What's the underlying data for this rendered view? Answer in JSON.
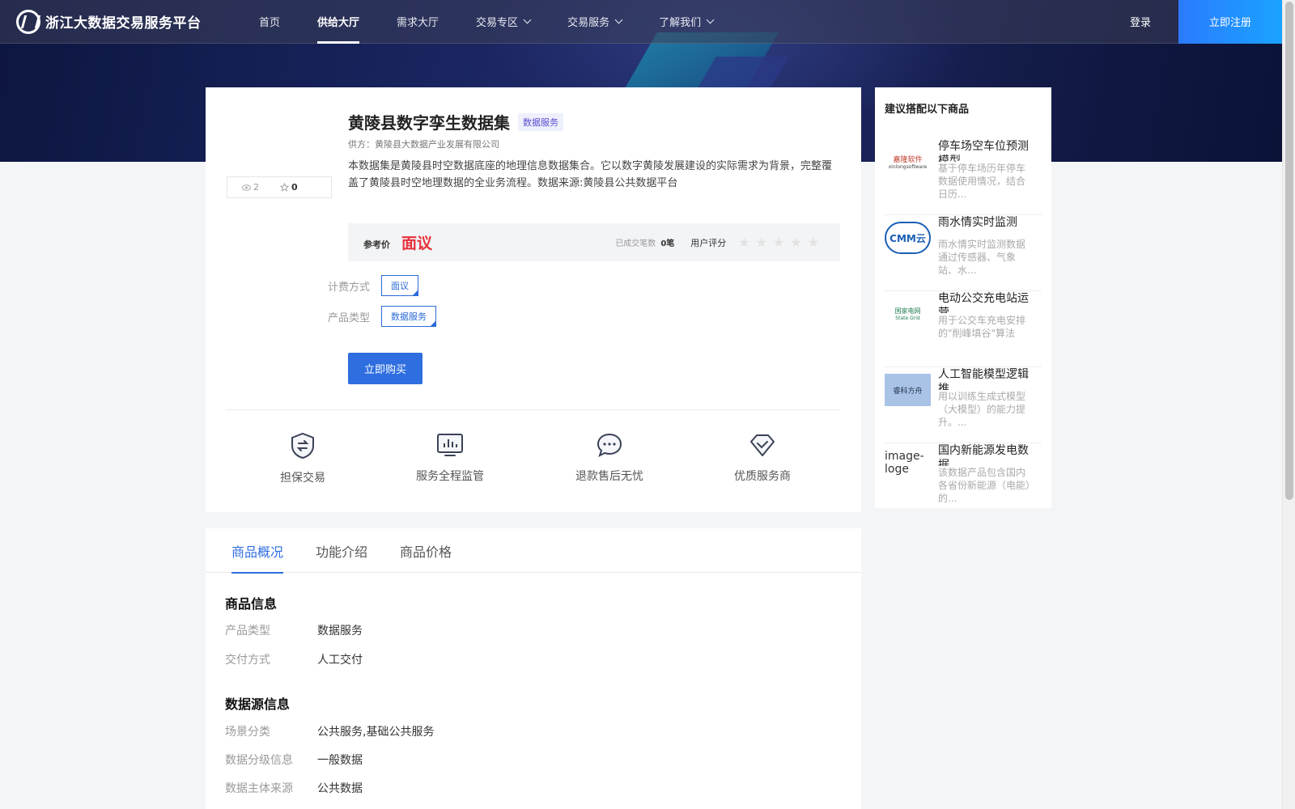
{
  "header": {
    "logo_text": "浙江大数据交易服务平台",
    "nav": [
      {
        "label": "首页",
        "active": false,
        "dropdown": false
      },
      {
        "label": "供给大厅",
        "active": true,
        "dropdown": false
      },
      {
        "label": "需求大厅",
        "active": false,
        "dropdown": false
      },
      {
        "label": "交易专区",
        "active": false,
        "dropdown": true
      },
      {
        "label": "交易服务",
        "active": false,
        "dropdown": true
      },
      {
        "label": "了解我们",
        "active": false,
        "dropdown": true
      }
    ],
    "login_label": "登录",
    "register_label": "立即注册"
  },
  "product": {
    "views": "2",
    "favorites": "0",
    "title": "黄陵县数字孪生数据集",
    "badge": "数据服务",
    "supplier": "供方：黄陵县大数据产业发展有限公司",
    "description": "本数据集是黄陵县时空数据底座的地理信息数据集合。它以数字黄陵发展建设的实际需求为背景，完整覆盖了黄陵县时空地理数据的全业务流程。数据来源:黄陵县公共数据平台",
    "price_label": "参考价",
    "price_value": "面议",
    "deals_label": "已成交笔数",
    "deals_value": "0笔",
    "rating_label": "用户评分",
    "rating_stars": 0,
    "billing_label": "计费方式",
    "billing_value": "面议",
    "type_label": "产品类型",
    "type_value": "数据服务",
    "buy_label": "立即购买"
  },
  "features": [
    {
      "label": "担保交易",
      "icon": "shield-exchange-icon"
    },
    {
      "label": "服务全程监管",
      "icon": "monitor-chart-icon"
    },
    {
      "label": "退款售后无忧",
      "icon": "chat-bubble-icon"
    },
    {
      "label": "优质服务商",
      "icon": "diamond-check-icon"
    }
  ],
  "side": {
    "title": "建议搭配以下商品",
    "items": [
      {
        "name": "停车场空车位预测模型",
        "desc": "基于停车场历年停车数据使用情况，结合日历...",
        "logo_text": "嘉隆软件",
        "logo_sub": "xinlongsoftware"
      },
      {
        "name": "雨水情实时监测",
        "desc": "雨水情实时监测数据通过传感器、气象站、水...",
        "logo_text": "CMM云",
        "logo_sub": ""
      },
      {
        "name": "电动公交充电站运营",
        "desc": "用于公交车充电安排的\"削峰填谷\"算法",
        "logo_text": "国家电网",
        "logo_sub": "State Grid"
      },
      {
        "name": "人工智能模型逻辑推",
        "desc": "用以训练生成式模型（大模型）的能力提升。...",
        "logo_text": "睿科方舟",
        "logo_sub": ""
      },
      {
        "name": "国内新能源发电数据",
        "desc": "该数据产品包含国内各省份新能源（电能）的...",
        "logo_text": "image-loge",
        "logo_sub": ""
      }
    ]
  },
  "detail": {
    "tabs": [
      {
        "label": "商品概况",
        "active": true
      },
      {
        "label": "功能介绍",
        "active": false
      },
      {
        "label": "商品价格",
        "active": false
      }
    ],
    "goods_info_title": "商品信息",
    "goods_info": [
      {
        "k": "产品类型",
        "v": "数据服务"
      },
      {
        "k": "交付方式",
        "v": "人工交付"
      }
    ],
    "source_info_title": "数据源信息",
    "source_info": [
      {
        "k": "场景分类",
        "v": "公共服务,基础公共服务"
      },
      {
        "k": "数据分级信息",
        "v": "一般数据"
      },
      {
        "k": "数据主体来源",
        "v": "公共数据"
      }
    ]
  },
  "colors": {
    "accent": "#2e6ee0",
    "price": "#e6303b",
    "badge_text": "#5a4cd0"
  }
}
